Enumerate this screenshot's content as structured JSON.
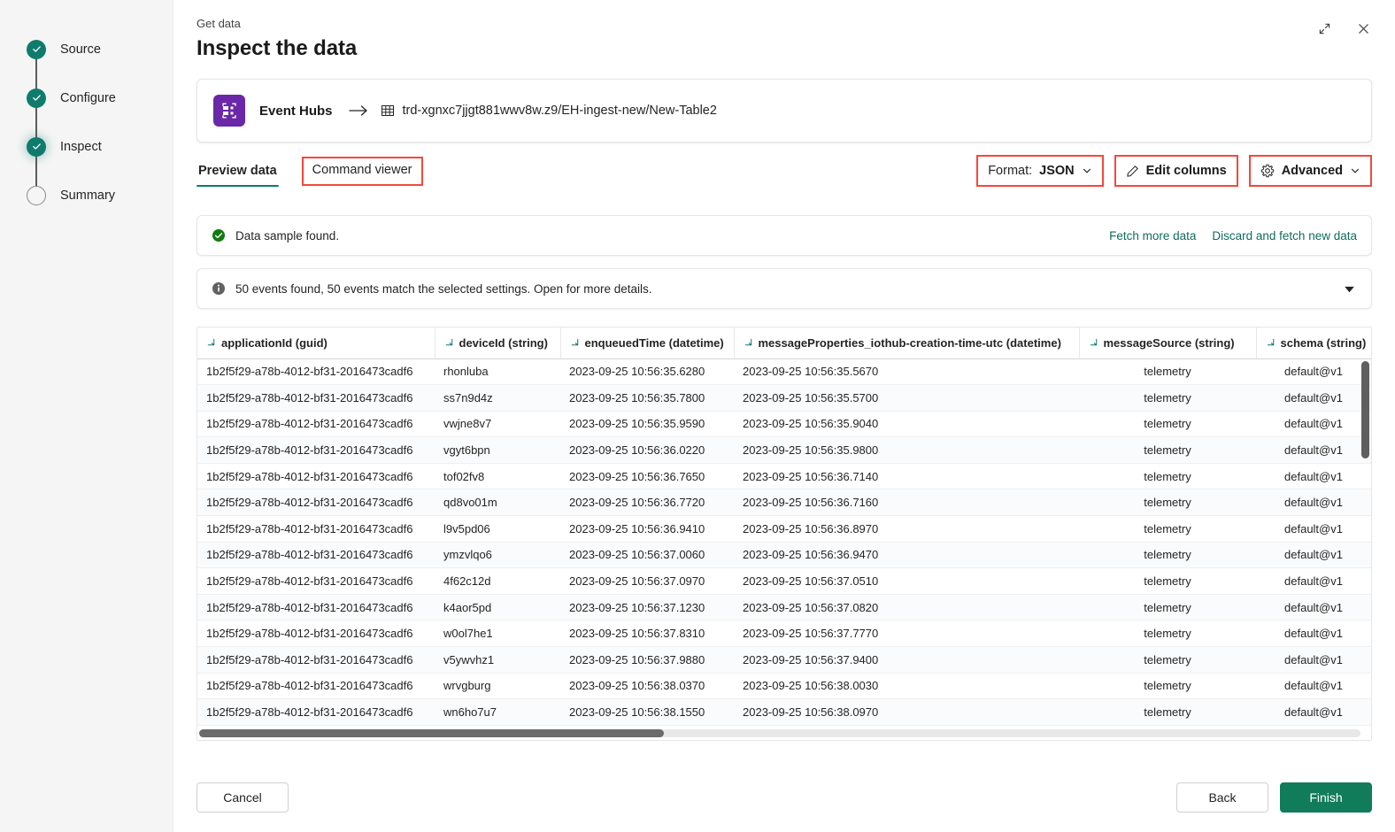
{
  "sidebar": {
    "steps": [
      {
        "label": "Source",
        "state": "done"
      },
      {
        "label": "Configure",
        "state": "done"
      },
      {
        "label": "Inspect",
        "state": "current"
      },
      {
        "label": "Summary",
        "state": "todo"
      }
    ]
  },
  "header": {
    "eyebrow": "Get data",
    "title": "Inspect the data",
    "expand_icon": "expand-icon",
    "close_icon": "close-icon"
  },
  "source_card": {
    "icon": "event-hubs-icon",
    "source_name": "Event Hubs",
    "arrow_icon": "arrow-right-icon",
    "table_icon": "table-icon",
    "destination_path": "trd-xgnxc7jjgt881wwv8w.z9/EH-ingest-new/New-Table2"
  },
  "tabs": [
    {
      "label": "Preview data",
      "active": true,
      "highlighted": false
    },
    {
      "label": "Command viewer",
      "active": false,
      "highlighted": true
    }
  ],
  "toolbar": {
    "format_label": "Format:",
    "format_value": "JSON",
    "format_chevron": "chevron-down-icon",
    "edit_columns_label": "Edit columns",
    "edit_columns_icon": "pencil-icon",
    "advanced_label": "Advanced",
    "advanced_icon": "gear-icon",
    "advanced_chevron": "chevron-down-icon"
  },
  "notices": {
    "success": {
      "icon": "success-check-icon",
      "text": "Data sample found.",
      "links": [
        "Fetch more data",
        "Discard and fetch new data"
      ]
    },
    "info": {
      "icon": "info-icon",
      "text": "50 events found, 50 events match the selected settings. Open for more details.",
      "expand_icon": "chevron-down-filled-icon"
    }
  },
  "table": {
    "columns": [
      {
        "name": "applicationId (guid)",
        "sort_icon": "sort-icon"
      },
      {
        "name": "deviceId (string)",
        "sort_icon": "sort-icon"
      },
      {
        "name": "enqueuedTime (datetime)",
        "sort_icon": "sort-icon"
      },
      {
        "name": "messageProperties_iothub-creation-time-utc (datetime)",
        "sort_icon": "sort-icon"
      },
      {
        "name": "messageSource (string)",
        "sort_icon": "sort-icon"
      },
      {
        "name": "schema (string)",
        "sort_icon": "sort-icon"
      }
    ],
    "rows": [
      [
        "1b2f5f29-a78b-4012-bf31-2016473cadf6",
        "rhonluba",
        "2023-09-25 10:56:35.6280",
        "2023-09-25 10:56:35.5670",
        "telemetry",
        "default@v1"
      ],
      [
        "1b2f5f29-a78b-4012-bf31-2016473cadf6",
        "ss7n9d4z",
        "2023-09-25 10:56:35.7800",
        "2023-09-25 10:56:35.5700",
        "telemetry",
        "default@v1"
      ],
      [
        "1b2f5f29-a78b-4012-bf31-2016473cadf6",
        "vwjne8v7",
        "2023-09-25 10:56:35.9590",
        "2023-09-25 10:56:35.9040",
        "telemetry",
        "default@v1"
      ],
      [
        "1b2f5f29-a78b-4012-bf31-2016473cadf6",
        "vgyt6bpn",
        "2023-09-25 10:56:36.0220",
        "2023-09-25 10:56:35.9800",
        "telemetry",
        "default@v1"
      ],
      [
        "1b2f5f29-a78b-4012-bf31-2016473cadf6",
        "tof02fv8",
        "2023-09-25 10:56:36.7650",
        "2023-09-25 10:56:36.7140",
        "telemetry",
        "default@v1"
      ],
      [
        "1b2f5f29-a78b-4012-bf31-2016473cadf6",
        "qd8vo01m",
        "2023-09-25 10:56:36.7720",
        "2023-09-25 10:56:36.7160",
        "telemetry",
        "default@v1"
      ],
      [
        "1b2f5f29-a78b-4012-bf31-2016473cadf6",
        "l9v5pd06",
        "2023-09-25 10:56:36.9410",
        "2023-09-25 10:56:36.8970",
        "telemetry",
        "default@v1"
      ],
      [
        "1b2f5f29-a78b-4012-bf31-2016473cadf6",
        "ymzvlqo6",
        "2023-09-25 10:56:37.0060",
        "2023-09-25 10:56:36.9470",
        "telemetry",
        "default@v1"
      ],
      [
        "1b2f5f29-a78b-4012-bf31-2016473cadf6",
        "4f62c12d",
        "2023-09-25 10:56:37.0970",
        "2023-09-25 10:56:37.0510",
        "telemetry",
        "default@v1"
      ],
      [
        "1b2f5f29-a78b-4012-bf31-2016473cadf6",
        "k4aor5pd",
        "2023-09-25 10:56:37.1230",
        "2023-09-25 10:56:37.0820",
        "telemetry",
        "default@v1"
      ],
      [
        "1b2f5f29-a78b-4012-bf31-2016473cadf6",
        "w0ol7he1",
        "2023-09-25 10:56:37.8310",
        "2023-09-25 10:56:37.7770",
        "telemetry",
        "default@v1"
      ],
      [
        "1b2f5f29-a78b-4012-bf31-2016473cadf6",
        "v5ywvhz1",
        "2023-09-25 10:56:37.9880",
        "2023-09-25 10:56:37.9400",
        "telemetry",
        "default@v1"
      ],
      [
        "1b2f5f29-a78b-4012-bf31-2016473cadf6",
        "wrvgburg",
        "2023-09-25 10:56:38.0370",
        "2023-09-25 10:56:38.0030",
        "telemetry",
        "default@v1"
      ],
      [
        "1b2f5f29-a78b-4012-bf31-2016473cadf6",
        "wn6ho7u7",
        "2023-09-25 10:56:38.1550",
        "2023-09-25 10:56:38.0970",
        "telemetry",
        "default@v1"
      ]
    ]
  },
  "footer": {
    "cancel_label": "Cancel",
    "back_label": "Back",
    "finish_label": "Finish"
  },
  "colors": {
    "accent_teal": "#0f7b6c",
    "primary_button": "#107c5a",
    "highlight_red": "#f5483b",
    "event_hubs_purple": "#6a28a8",
    "success_green": "#107c10",
    "info_gray": "#616161"
  }
}
